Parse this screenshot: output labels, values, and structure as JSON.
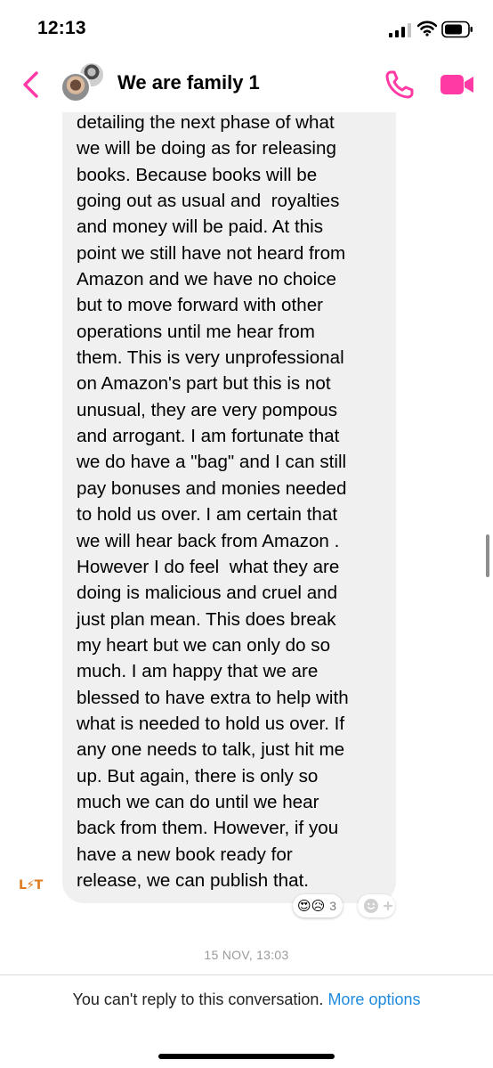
{
  "status_bar": {
    "time": "12:13",
    "icons": [
      "cellular-signal-icon",
      "wifi-icon",
      "battery-icon"
    ]
  },
  "header": {
    "back_icon": "chevron-left-icon",
    "title": "We are family 1",
    "call_icon": "phone-icon",
    "video_icon": "video-camera-icon",
    "accent_color": "#ff3aa5"
  },
  "message": {
    "text": "detailing the next phase of what\nwe will be doing as for releasing\nbooks. Because books will be\ngoing out as usual and  royalties\nand money will be paid. At this\npoint we still have not heard from\nAmazon and we have no choice\nbut to move forward with other\noperations until me hear from\nthem. This is very unprofessional\non Amazon's part but this is not\nunusual, they are very pompous\nand arrogant. I am fortunate that\nwe do have a \"bag\" and I can still\npay bonuses and monies needed\nto hold us over. I am certain that\nwe will hear back from Amazon .\nHowever I do feel  what they are\ndoing is malicious and cruel and\njust plan mean. This does break\nmy heart but we can only do so\nmuch. I am happy that we are\nblessed to have extra to help with\nwhat is needed to hold us over. If\nany one needs to talk, just hit me\nup. But again, there is only so\nmuch we can do until we hear\nback from them. However, if you\nhave a new book ready for\nrelease, we can publish that.",
    "sender_logo": "L⚡T",
    "reactions": {
      "emojis": "😍😥",
      "count": "3"
    },
    "bubble_color": "#f0f0f0"
  },
  "timestamp": "15 NOV, 13:03",
  "footer": {
    "notice": "You can't reply to this conversation.",
    "link": "More options",
    "link_color": "#1f8be0"
  }
}
